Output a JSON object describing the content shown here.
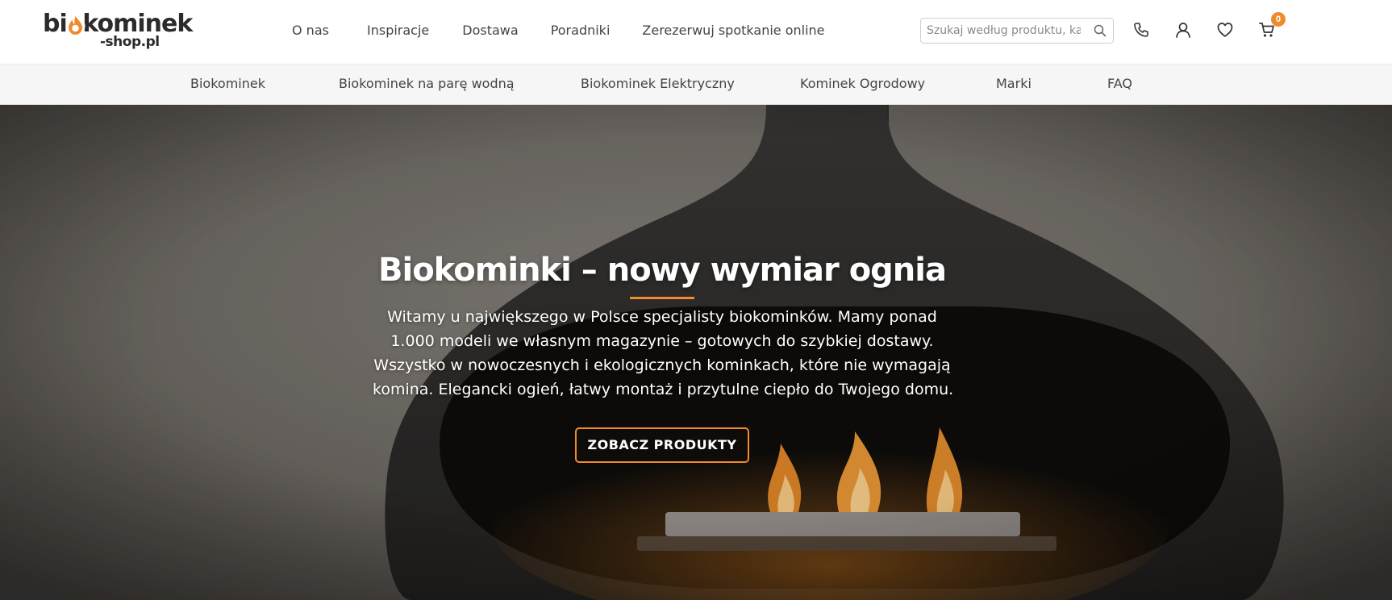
{
  "brand": {
    "logo_main": "biokominek",
    "logo_sub": "-shop.pl",
    "accent_color": "#f08a2e"
  },
  "main_nav": [
    {
      "label": "O nas"
    },
    {
      "label": "Inspiracje"
    },
    {
      "label": "Dostawa"
    },
    {
      "label": "Poradniki"
    },
    {
      "label": "Zerezerwuj spotkanie online"
    }
  ],
  "search": {
    "placeholder": "Szukaj według produktu, kate",
    "icon": "search-icon"
  },
  "header_icons": [
    "phone-icon",
    "user-icon",
    "heart-icon",
    "cart-icon"
  ],
  "cart": {
    "count": "0"
  },
  "categories": [
    {
      "label": "Biokominek"
    },
    {
      "label": "Biokominek na parę wodną"
    },
    {
      "label": "Biokominek Elektryczny"
    },
    {
      "label": "Kominek Ogrodowy"
    },
    {
      "label": "Marki"
    },
    {
      "label": "FAQ"
    }
  ],
  "hero": {
    "title": "Biokominki – nowy wymiar ognia",
    "text_lines": [
      "Witamy u największego w Polsce specjalisty biokominków. Mamy ponad",
      "1.000 modeli we własnym magazynie – gotowych do szybkiej dostawy.",
      "Wszystko w nowoczesnych i ekologicznych kominkach, które nie wymagają",
      "komina. Elegancki ogień, łatwy montaż i przytulne ciepło do Twojego domu."
    ],
    "cta_label": "ZOBACZ PRODUKTY"
  }
}
